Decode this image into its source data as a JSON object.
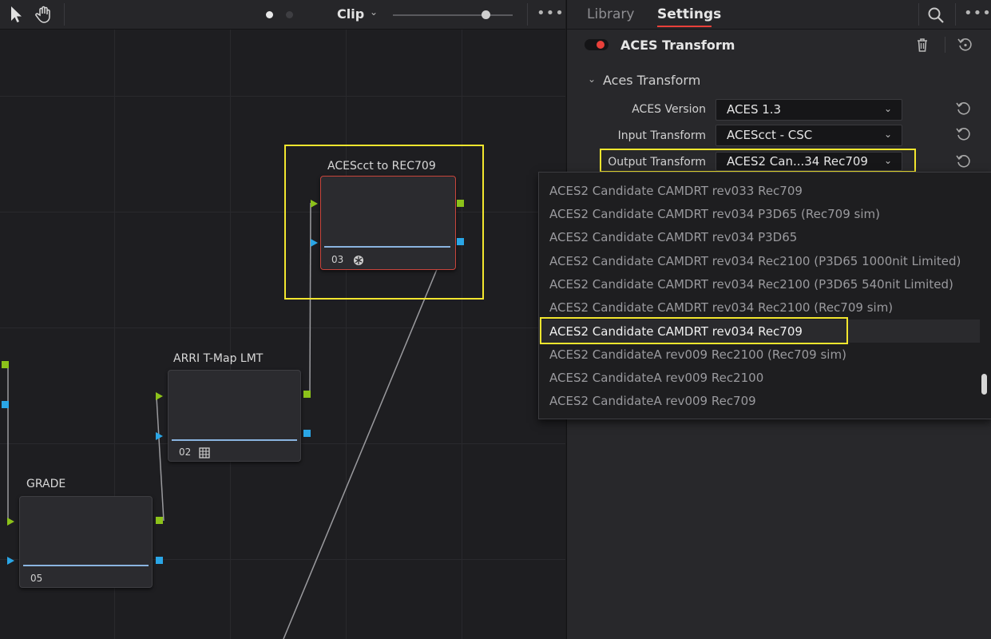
{
  "toolbar": {
    "view_label": "Clip",
    "more_icon": "ellipsis-icon"
  },
  "panel": {
    "tabs": [
      {
        "label": "Library",
        "active": false
      },
      {
        "label": "Settings",
        "active": true
      }
    ],
    "effect_title": "ACES Transform",
    "section_title": "Aces Transform",
    "params": [
      {
        "label": "ACES Version",
        "value": "ACES 1.3"
      },
      {
        "label": "Input Transform",
        "value": "ACEScct - CSC"
      },
      {
        "label": "Output Transform",
        "value": "ACES2 Can...34 Rec709"
      }
    ]
  },
  "nodes": [
    {
      "title": "ACEScct to REC709",
      "number": "03"
    },
    {
      "title": "ARRI T-Map LMT",
      "number": "02"
    },
    {
      "title": "GRADE",
      "number": "05"
    }
  ],
  "output_transform_options": [
    "ACES2 Candidate CAMDRT rev033 Rec709",
    "ACES2 Candidate CAMDRT rev034 P3D65 (Rec709 sim)",
    "ACES2 Candidate CAMDRT rev034 P3D65",
    "ACES2 Candidate CAMDRT rev034 Rec2100 (P3D65 1000nit Limited)",
    "ACES2 Candidate CAMDRT rev034 Rec2100 (P3D65 540nit Limited)",
    "ACES2 Candidate CAMDRT rev034 Rec2100 (Rec709 sim)",
    "ACES2 Candidate CAMDRT rev034 Rec709",
    "ACES2 CandidateA rev009 Rec2100 (Rec709 sim)",
    "ACES2 CandidateA rev009 Rec2100",
    "ACES2 CandidateA rev009 Rec709"
  ],
  "selected_option": "ACES2 Candidate CAMDRT rev034 Rec709",
  "colors": {
    "highlight": "#f2e62e",
    "accent_red": "#e8403a",
    "input_green": "#8cc21a",
    "input_blue": "#2aa6e6"
  }
}
